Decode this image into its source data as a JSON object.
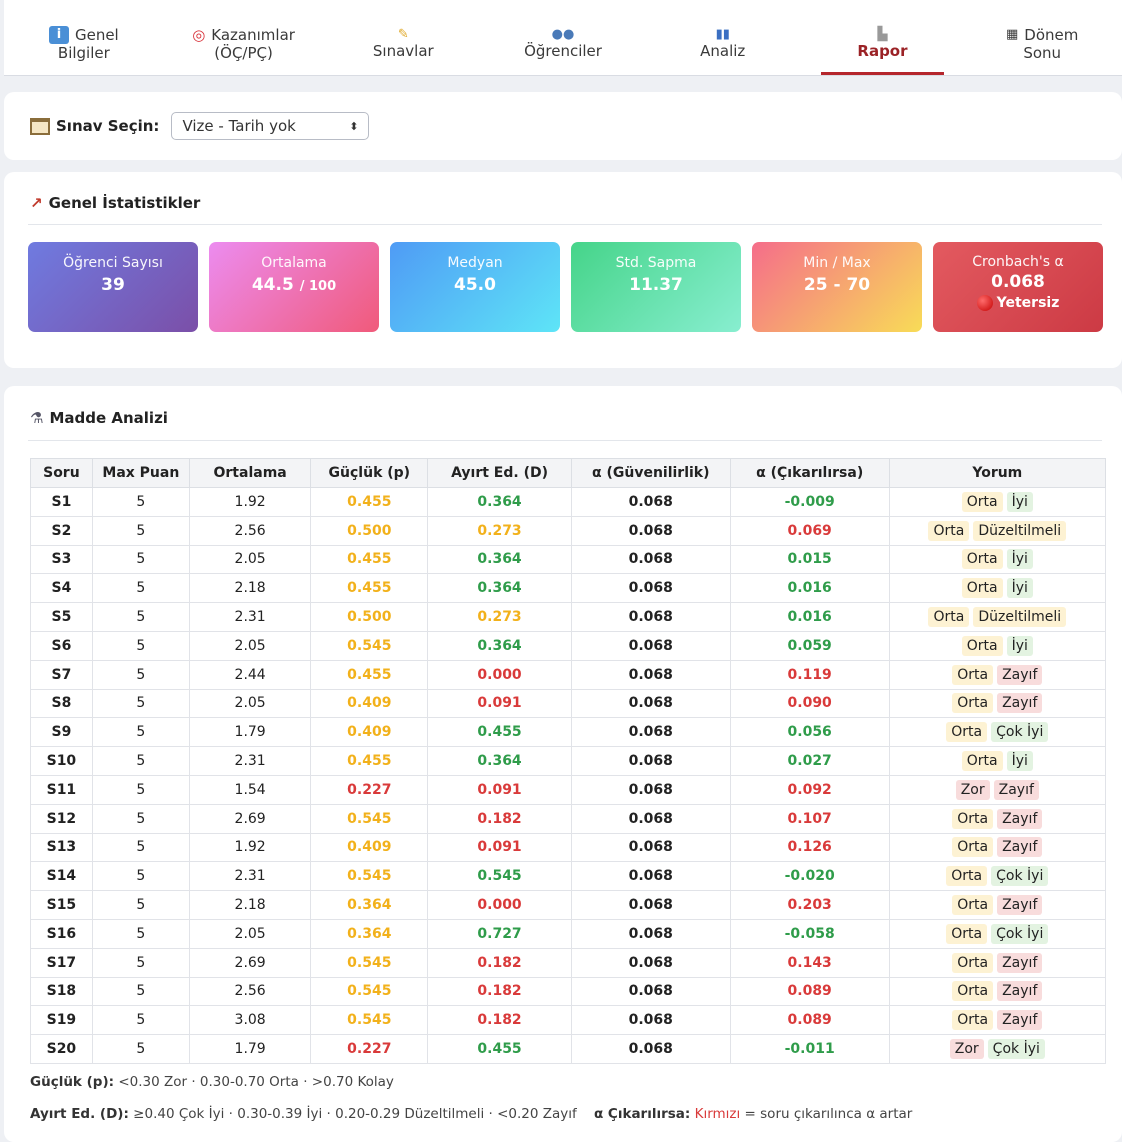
{
  "tabs": [
    {
      "icon": "info-icon",
      "line1": "Genel",
      "line2": "Bilgiler",
      "active": false
    },
    {
      "icon": "target-icon",
      "line1": "Kazanımlar",
      "line2": "(ÖÇ/PÇ)",
      "active": false
    },
    {
      "icon": "pencil-icon",
      "label": "Sınavlar",
      "active": false
    },
    {
      "icon": "users-icon",
      "label": "Öğrenciler",
      "active": false
    },
    {
      "icon": "chart-icon",
      "label": "Analiz",
      "active": false
    },
    {
      "icon": "page-icon",
      "label": "Rapor",
      "active": true
    },
    {
      "icon": "checkered-flag-icon",
      "line1": "Dönem",
      "line2": "Sonu",
      "active": false
    }
  ],
  "exam_select": {
    "label": "Sınav Seçin:",
    "value": "Vize - Tarih yok"
  },
  "general_stats": {
    "title": "Genel İstatistikler",
    "cards": {
      "students": {
        "label": "Öğrenci Sayısı",
        "value": "39"
      },
      "mean": {
        "label": "Ortalama",
        "value": "44.5",
        "suffix": "/ 100"
      },
      "median": {
        "label": "Medyan",
        "value": "45.0"
      },
      "std": {
        "label": "Std. Sapma",
        "value": "11.37"
      },
      "minmax": {
        "label": "Min / Max",
        "value": "25 - 70"
      },
      "alpha": {
        "label": "Cronbach's α",
        "value": "0.068",
        "status": "Yetersiz"
      }
    }
  },
  "item_analysis": {
    "title": "Madde Analizi",
    "headers": [
      "Soru",
      "Max Puan",
      "Ortalama",
      "Güçlük (p)",
      "Ayırt Ed. (D)",
      "α (Güvenilirlik)",
      "α (Çıkarılırsa)",
      "Yorum"
    ],
    "rows": [
      {
        "soru": "S1",
        "max": "5",
        "ort": "1.92",
        "p": "0.455",
        "pc": "yel",
        "d": "0.364",
        "dc": "grn",
        "a": "0.068",
        "ac": "-0.009",
        "acc": "grn",
        "y1": "Orta",
        "y1c": "orta",
        "y2": "İyi",
        "y2c": "iyi"
      },
      {
        "soru": "S2",
        "max": "5",
        "ort": "2.56",
        "p": "0.500",
        "pc": "yel",
        "d": "0.273",
        "dc": "yel",
        "a": "0.068",
        "ac": "0.069",
        "acc": "red",
        "y1": "Orta",
        "y1c": "orta",
        "y2": "Düzeltilmeli",
        "y2c": "duz"
      },
      {
        "soru": "S3",
        "max": "5",
        "ort": "2.05",
        "p": "0.455",
        "pc": "yel",
        "d": "0.364",
        "dc": "grn",
        "a": "0.068",
        "ac": "0.015",
        "acc": "grn",
        "y1": "Orta",
        "y1c": "orta",
        "y2": "İyi",
        "y2c": "iyi"
      },
      {
        "soru": "S4",
        "max": "5",
        "ort": "2.18",
        "p": "0.455",
        "pc": "yel",
        "d": "0.364",
        "dc": "grn",
        "a": "0.068",
        "ac": "0.016",
        "acc": "grn",
        "y1": "Orta",
        "y1c": "orta",
        "y2": "İyi",
        "y2c": "iyi"
      },
      {
        "soru": "S5",
        "max": "5",
        "ort": "2.31",
        "p": "0.500",
        "pc": "yel",
        "d": "0.273",
        "dc": "yel",
        "a": "0.068",
        "ac": "0.016",
        "acc": "grn",
        "y1": "Orta",
        "y1c": "orta",
        "y2": "Düzeltilmeli",
        "y2c": "duz"
      },
      {
        "soru": "S6",
        "max": "5",
        "ort": "2.05",
        "p": "0.545",
        "pc": "yel",
        "d": "0.364",
        "dc": "grn",
        "a": "0.068",
        "ac": "0.059",
        "acc": "grn",
        "y1": "Orta",
        "y1c": "orta",
        "y2": "İyi",
        "y2c": "iyi"
      },
      {
        "soru": "S7",
        "max": "5",
        "ort": "2.44",
        "p": "0.455",
        "pc": "yel",
        "d": "0.000",
        "dc": "red",
        "a": "0.068",
        "ac": "0.119",
        "acc": "red",
        "y1": "Orta",
        "y1c": "orta",
        "y2": "Zayıf",
        "y2c": "zayif"
      },
      {
        "soru": "S8",
        "max": "5",
        "ort": "2.05",
        "p": "0.409",
        "pc": "yel",
        "d": "0.091",
        "dc": "red",
        "a": "0.068",
        "ac": "0.090",
        "acc": "red",
        "y1": "Orta",
        "y1c": "orta",
        "y2": "Zayıf",
        "y2c": "zayif"
      },
      {
        "soru": "S9",
        "max": "5",
        "ort": "1.79",
        "p": "0.409",
        "pc": "yel",
        "d": "0.455",
        "dc": "grn",
        "a": "0.068",
        "ac": "0.056",
        "acc": "grn",
        "y1": "Orta",
        "y1c": "orta",
        "y2": "Çok İyi",
        "y2c": "cokiyi"
      },
      {
        "soru": "S10",
        "max": "5",
        "ort": "2.31",
        "p": "0.455",
        "pc": "yel",
        "d": "0.364",
        "dc": "grn",
        "a": "0.068",
        "ac": "0.027",
        "acc": "grn",
        "y1": "Orta",
        "y1c": "orta",
        "y2": "İyi",
        "y2c": "iyi"
      },
      {
        "soru": "S11",
        "max": "5",
        "ort": "1.54",
        "p": "0.227",
        "pc": "red",
        "d": "0.091",
        "dc": "red",
        "a": "0.068",
        "ac": "0.092",
        "acc": "red",
        "y1": "Zor",
        "y1c": "zor",
        "y2": "Zayıf",
        "y2c": "zayif"
      },
      {
        "soru": "S12",
        "max": "5",
        "ort": "2.69",
        "p": "0.545",
        "pc": "yel",
        "d": "0.182",
        "dc": "red",
        "a": "0.068",
        "ac": "0.107",
        "acc": "red",
        "y1": "Orta",
        "y1c": "orta",
        "y2": "Zayıf",
        "y2c": "zayif"
      },
      {
        "soru": "S13",
        "max": "5",
        "ort": "1.92",
        "p": "0.409",
        "pc": "yel",
        "d": "0.091",
        "dc": "red",
        "a": "0.068",
        "ac": "0.126",
        "acc": "red",
        "y1": "Orta",
        "y1c": "orta",
        "y2": "Zayıf",
        "y2c": "zayif"
      },
      {
        "soru": "S14",
        "max": "5",
        "ort": "2.31",
        "p": "0.545",
        "pc": "yel",
        "d": "0.545",
        "dc": "grn",
        "a": "0.068",
        "ac": "-0.020",
        "acc": "grn",
        "y1": "Orta",
        "y1c": "orta",
        "y2": "Çok İyi",
        "y2c": "cokiyi"
      },
      {
        "soru": "S15",
        "max": "5",
        "ort": "2.18",
        "p": "0.364",
        "pc": "yel",
        "d": "0.000",
        "dc": "red",
        "a": "0.068",
        "ac": "0.203",
        "acc": "red",
        "y1": "Orta",
        "y1c": "orta",
        "y2": "Zayıf",
        "y2c": "zayif"
      },
      {
        "soru": "S16",
        "max": "5",
        "ort": "2.05",
        "p": "0.364",
        "pc": "yel",
        "d": "0.727",
        "dc": "grn",
        "a": "0.068",
        "ac": "-0.058",
        "acc": "grn",
        "y1": "Orta",
        "y1c": "orta",
        "y2": "Çok İyi",
        "y2c": "cokiyi"
      },
      {
        "soru": "S17",
        "max": "5",
        "ort": "2.69",
        "p": "0.545",
        "pc": "yel",
        "d": "0.182",
        "dc": "red",
        "a": "0.068",
        "ac": "0.143",
        "acc": "red",
        "y1": "Orta",
        "y1c": "orta",
        "y2": "Zayıf",
        "y2c": "zayif"
      },
      {
        "soru": "S18",
        "max": "5",
        "ort": "2.56",
        "p": "0.545",
        "pc": "yel",
        "d": "0.182",
        "dc": "red",
        "a": "0.068",
        "ac": "0.089",
        "acc": "red",
        "y1": "Orta",
        "y1c": "orta",
        "y2": "Zayıf",
        "y2c": "zayif"
      },
      {
        "soru": "S19",
        "max": "5",
        "ort": "3.08",
        "p": "0.545",
        "pc": "yel",
        "d": "0.182",
        "dc": "red",
        "a": "0.068",
        "ac": "0.089",
        "acc": "red",
        "y1": "Orta",
        "y1c": "orta",
        "y2": "Zayıf",
        "y2c": "zayif"
      },
      {
        "soru": "S20",
        "max": "5",
        "ort": "1.79",
        "p": "0.227",
        "pc": "red",
        "d": "0.455",
        "dc": "grn",
        "a": "0.068",
        "ac": "-0.011",
        "acc": "grn",
        "y1": "Zor",
        "y1c": "zor",
        "y2": "Çok İyi",
        "y2c": "cokiyi"
      }
    ],
    "legend1": {
      "key": "Güçlük (p):",
      "text": "<0.30 Zor · 0.30-0.70 Orta · >0.70 Kolay"
    },
    "legend2": {
      "key": "Ayırt Ed. (D):",
      "text": "≥0.40 Çok İyi · 0.30-0.39 İyi · 0.20-0.29 Düzeltilmeli · <0.20 Zayıf",
      "key2": "α Çıkarılırsa:",
      "red_word": "Kırmızı",
      "tail": "= soru çıkarılınca α artar"
    }
  },
  "colors": {
    "yellow": "#f2b11b",
    "green": "#2f9c4a",
    "red": "#d93a3a",
    "active_tab": "#b5262c"
  }
}
